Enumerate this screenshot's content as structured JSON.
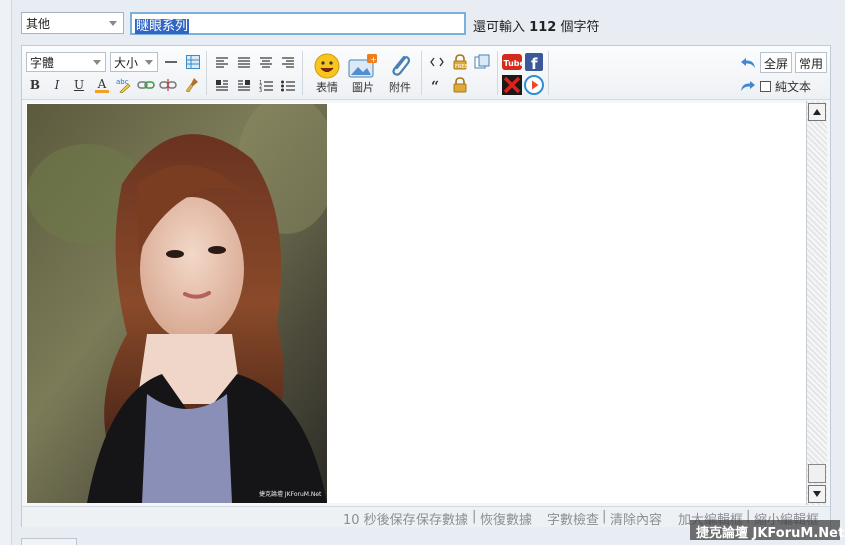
{
  "header": {
    "category_select": "其他",
    "title_value": "瞇眼系列",
    "remaining_prefix": "還可輸入",
    "remaining_count": "112",
    "remaining_suffix": "個字符"
  },
  "toolbar": {
    "font_combo": "字體",
    "size_combo": "大小",
    "emoticon_label": "表情",
    "image_label": "圖片",
    "attachment_label": "附件",
    "fullscreen_label": "全屏",
    "common_label": "常用",
    "plaintext_label": "純文本",
    "bold": "B",
    "italic": "I",
    "underline": "U",
    "fontcolor": "A",
    "youtube": "Tube",
    "facebook": "f"
  },
  "content": {
    "photo_caption": "捷克論壇 JKForuM.Net"
  },
  "status": {
    "autosave": "10 秒後保存",
    "save_data": "保存數據",
    "restore_data": "恢復數據",
    "word_check": "字數檢查",
    "clear_content": "清除內容",
    "enlarge": "加大編輯框",
    "shrink": "縮小編輯框",
    "divider": "|"
  },
  "watermark": "捷克論壇 JKForuM.Net",
  "colors": {
    "accent": "#3166c6",
    "input_border": "#7ab0dc",
    "background": "#e8edf3"
  }
}
